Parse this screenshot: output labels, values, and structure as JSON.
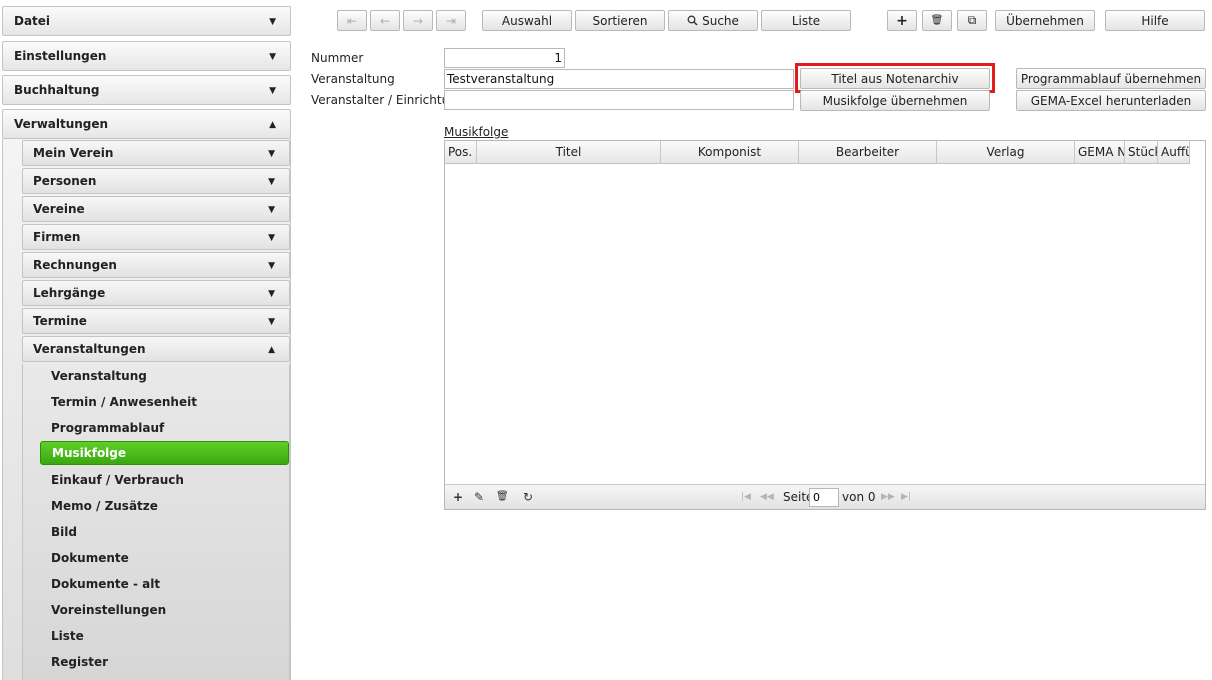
{
  "sidebar": {
    "top_sections": [
      {
        "label": "Datei",
        "arrow": "▼"
      },
      {
        "label": "Einstellungen",
        "arrow": "▼"
      },
      {
        "label": "Buchhaltung",
        "arrow": "▼"
      },
      {
        "label": "Verwaltungen",
        "arrow": "▲"
      }
    ],
    "sub_sections": [
      {
        "label": "Mein Verein",
        "arrow": "▼"
      },
      {
        "label": "Personen",
        "arrow": "▼"
      },
      {
        "label": "Vereine",
        "arrow": "▼"
      },
      {
        "label": "Firmen",
        "arrow": "▼"
      },
      {
        "label": "Rechnungen",
        "arrow": "▼"
      },
      {
        "label": "Lehrgänge",
        "arrow": "▼"
      },
      {
        "label": "Termine",
        "arrow": "▼"
      },
      {
        "label": "Veranstaltungen",
        "arrow": "▲"
      }
    ],
    "leaf_items": [
      {
        "label": "Veranstaltung"
      },
      {
        "label": "Termin / Anwesenheit"
      },
      {
        "label": "Programmablauf"
      },
      {
        "label": "Musikfolge",
        "active": true
      },
      {
        "label": "Einkauf / Verbrauch"
      },
      {
        "label": "Memo / Zusätze"
      },
      {
        "label": "Bild"
      },
      {
        "label": "Dokumente"
      },
      {
        "label": "Dokumente - alt"
      },
      {
        "label": "Voreinstellungen"
      },
      {
        "label": "Liste"
      },
      {
        "label": "Register"
      }
    ]
  },
  "toolbar": {
    "nav_first": "⇤",
    "nav_prev": "←",
    "nav_next": "→",
    "nav_last": "⇥",
    "auswahl": "Auswahl",
    "sortieren": "Sortieren",
    "suche": "Suche",
    "liste": "Liste",
    "add": "+",
    "delete": "🗑",
    "copy": "⧉",
    "uebernehmen": "Übernehmen",
    "hilfe": "Hilfe"
  },
  "form": {
    "nummer_label": "Nummer",
    "nummer_value": "1",
    "veranstaltung_label": "Veranstaltung",
    "veranstaltung_value": "Testveranstaltung",
    "veranstalter_label": "Veranstalter / Einrichtung",
    "veranstalter_value": "",
    "btn_titel_notenarchiv": "Titel aus Notenarchiv",
    "btn_musikfolge_uebernehmen": "Musikfolge übernehmen",
    "btn_programmablauf_uebernehmen": "Programmablauf übernehmen",
    "btn_gema_excel": "GEMA-Excel herunterladen"
  },
  "grid": {
    "title": "Musikfolge",
    "columns": [
      {
        "label": "Pos."
      },
      {
        "label": "Titel"
      },
      {
        "label": "Komponist"
      },
      {
        "label": "Bearbeiter"
      },
      {
        "label": "Verlag"
      },
      {
        "label": "GEMA N"
      },
      {
        "label": "Stück"
      },
      {
        "label": "Auffü"
      }
    ],
    "rows": [],
    "footer": {
      "add_icon": "+",
      "edit_icon": "✎",
      "delete_icon": "🗑",
      "refresh_icon": "↻",
      "first": "|◀",
      "prev": "◀◀",
      "page_label": "Seite",
      "page_value": "0",
      "of_label": "von 0",
      "next": "▶▶",
      "last": "▶|"
    }
  }
}
